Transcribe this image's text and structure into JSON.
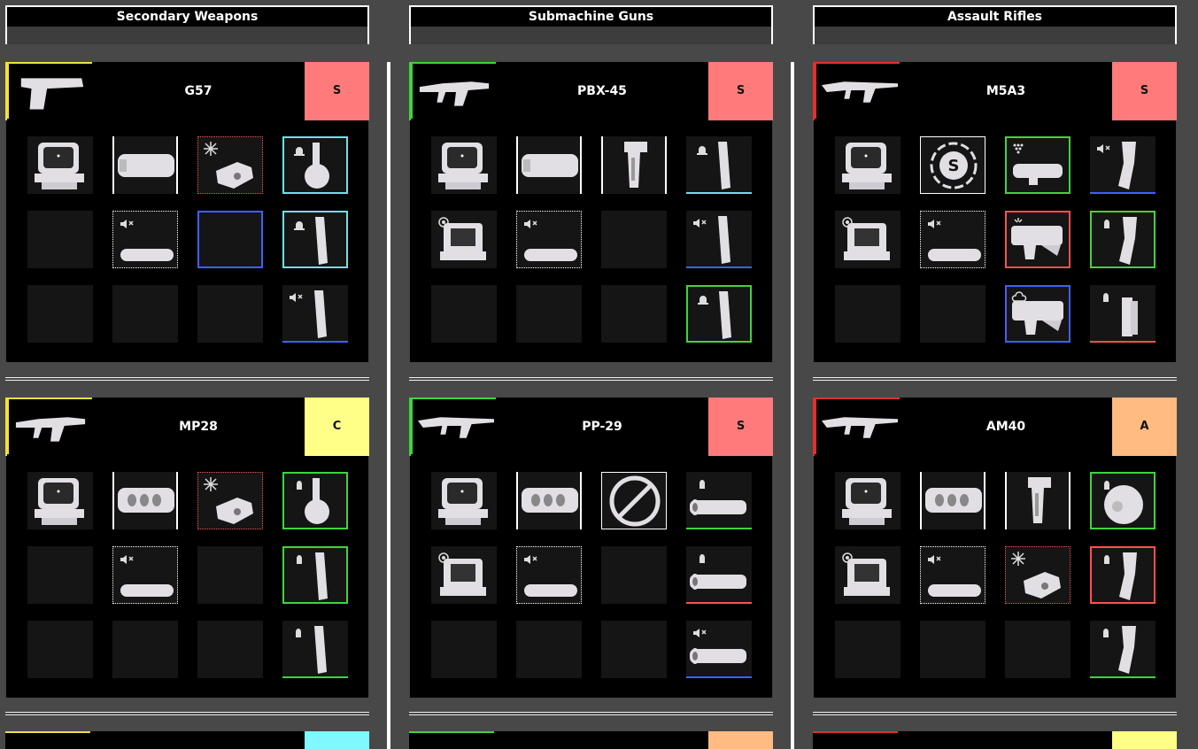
{
  "columns": [
    {
      "title": "Secondary Weapons",
      "accent": "#f0e040",
      "peek_tier_color": "#7ff8ff",
      "weapons": [
        {
          "name": "G57",
          "tier": "S",
          "tier_color": "#ff7b7b",
          "gun_icon": "pistol-icon",
          "slots": [
            {
              "icon": "sight-icon",
              "border": "none"
            },
            {
              "icon": "suppressor-icon",
              "border": "white-bars"
            },
            {
              "icon": "stock-icon",
              "border": "red-dotted",
              "badge": "sparkle"
            },
            {
              "icon": "drum-mag-icon",
              "border": "cyan",
              "badge": "bell"
            },
            {
              "icon": "",
              "border": "none"
            },
            {
              "icon": "silencer-icon",
              "border": "white-dotted",
              "badge": "mute"
            },
            {
              "icon": "",
              "border": "blue"
            },
            {
              "icon": "mag-icon",
              "border": "cyan",
              "badge": "bell"
            },
            {
              "icon": "",
              "border": "none"
            },
            {
              "icon": "",
              "border": "none"
            },
            {
              "icon": "",
              "border": "none"
            },
            {
              "icon": "mag-icon",
              "border": "blue-bottom",
              "badge": "mute"
            }
          ]
        },
        {
          "name": "MP28",
          "tier": "C",
          "tier_color": "#ffff88",
          "gun_icon": "smg-icon",
          "slots": [
            {
              "icon": "sight-icon",
              "border": "none"
            },
            {
              "icon": "compensator-icon",
              "border": "white-bars"
            },
            {
              "icon": "stock-icon",
              "border": "red-dotted",
              "badge": "sparkle"
            },
            {
              "icon": "drum-mag-icon",
              "border": "green",
              "badge": "bullet"
            },
            {
              "icon": "",
              "border": "none"
            },
            {
              "icon": "silencer-icon",
              "border": "white-dotted",
              "badge": "mute"
            },
            {
              "icon": "",
              "border": "none"
            },
            {
              "icon": "mag-icon",
              "border": "green",
              "badge": "bullet"
            },
            {
              "icon": "",
              "border": "none"
            },
            {
              "icon": "",
              "border": "none"
            },
            {
              "icon": "",
              "border": "none"
            },
            {
              "icon": "mag-icon",
              "border": "green-bottom",
              "badge": "bullet"
            }
          ]
        }
      ]
    },
    {
      "title": "Submachine Guns",
      "accent": "#3fd43f",
      "peek_tier_color": "#ffbb80",
      "weapons": [
        {
          "name": "PBX-45",
          "tier": "S",
          "tier_color": "#ff7b7b",
          "gun_icon": "smg-icon",
          "slots": [
            {
              "icon": "sight-icon",
              "border": "none"
            },
            {
              "icon": "suppressor-icon",
              "border": "white-bars"
            },
            {
              "icon": "grip-icon",
              "border": "white-bars"
            },
            {
              "icon": "mag-icon",
              "border": "cyan-bottom",
              "badge": "bell"
            },
            {
              "icon": "holo-icon",
              "border": "none",
              "badge": "eye"
            },
            {
              "icon": "silencer-icon",
              "border": "white-dotted",
              "badge": "mute"
            },
            {
              "icon": "",
              "border": "none"
            },
            {
              "icon": "mag-icon",
              "border": "blue-bottom",
              "badge": "mute"
            },
            {
              "icon": "",
              "border": "none"
            },
            {
              "icon": "",
              "border": "none"
            },
            {
              "icon": "",
              "border": "none"
            },
            {
              "icon": "mag-icon",
              "border": "green",
              "badge": "bell"
            }
          ]
        },
        {
          "name": "PP-29",
          "tier": "S",
          "tier_color": "#ff7b7b",
          "gun_icon": "rifle-icon",
          "slots": [
            {
              "icon": "sight-icon",
              "border": "none"
            },
            {
              "icon": "compensator-icon",
              "border": "white-bars"
            },
            {
              "icon": "blocked-icon",
              "border": "white"
            },
            {
              "icon": "barrel-icon",
              "border": "green-bottom",
              "badge": "bullet"
            },
            {
              "icon": "holo-icon",
              "border": "none",
              "badge": "eye"
            },
            {
              "icon": "silencer-icon",
              "border": "white-dotted",
              "badge": "mute"
            },
            {
              "icon": "",
              "border": "none"
            },
            {
              "icon": "barrel-icon",
              "border": "red-bottom",
              "badge": "bullet"
            },
            {
              "icon": "",
              "border": "none"
            },
            {
              "icon": "",
              "border": "none"
            },
            {
              "icon": "",
              "border": "none"
            },
            {
              "icon": "barrel-icon",
              "border": "blue-bottom",
              "badge": "mute"
            }
          ]
        }
      ]
    },
    {
      "title": "Assault Rifles",
      "accent": "#e03030",
      "peek_tier_color": "#ffff88",
      "weapons": [
        {
          "name": "M5A3",
          "tier": "S",
          "tier_color": "#ff7b7b",
          "gun_icon": "rifle-icon",
          "slots": [
            {
              "icon": "sight-icon",
              "border": "none"
            },
            {
              "icon": "s-badge-icon",
              "border": "white"
            },
            {
              "icon": "launcher-icon",
              "border": "green",
              "badge": "dots"
            },
            {
              "icon": "curved-mag-icon",
              "border": "blue-bottom",
              "badge": "mute"
            },
            {
              "icon": "holo-icon",
              "border": "none",
              "badge": "eye"
            },
            {
              "icon": "silencer-icon",
              "border": "white-dotted",
              "badge": "mute"
            },
            {
              "icon": "underbarrel-icon",
              "border": "red",
              "badge": "spray"
            },
            {
              "icon": "curved-mag-icon",
              "border": "green",
              "badge": "bullet"
            },
            {
              "icon": "",
              "border": "none"
            },
            {
              "icon": "",
              "border": "none"
            },
            {
              "icon": "underbarrel-icon",
              "border": "blue",
              "badge": "cloud"
            },
            {
              "icon": "double-mag-icon",
              "border": "red-bottom",
              "badge": "bullet"
            }
          ]
        },
        {
          "name": "AM40",
          "tier": "A",
          "tier_color": "#ffbb80",
          "gun_icon": "rifle-icon",
          "slots": [
            {
              "icon": "sight-icon",
              "border": "none"
            },
            {
              "icon": "compensator-icon",
              "border": "white-bars"
            },
            {
              "icon": "grip-icon",
              "border": "white-bars"
            },
            {
              "icon": "drum-round-icon",
              "border": "green",
              "badge": "bullet"
            },
            {
              "icon": "holo-icon",
              "border": "none",
              "badge": "eye"
            },
            {
              "icon": "silencer-icon",
              "border": "white-dotted",
              "badge": "mute"
            },
            {
              "icon": "stock-icon",
              "border": "red-dotted",
              "badge": "sparkle"
            },
            {
              "icon": "curved-mag-icon",
              "border": "red",
              "badge": "bullet"
            },
            {
              "icon": "",
              "border": "none"
            },
            {
              "icon": "",
              "border": "none"
            },
            {
              "icon": "",
              "border": "none"
            },
            {
              "icon": "curved-mag-icon",
              "border": "green-bottom",
              "badge": "bullet"
            }
          ]
        }
      ]
    }
  ],
  "palette": {
    "green": "#3fd43f",
    "cyan": "#6fe0e8",
    "blue": "#4060ff",
    "red": "#ff5050",
    "white": "#ffffff",
    "item": "#e2dfe4"
  }
}
